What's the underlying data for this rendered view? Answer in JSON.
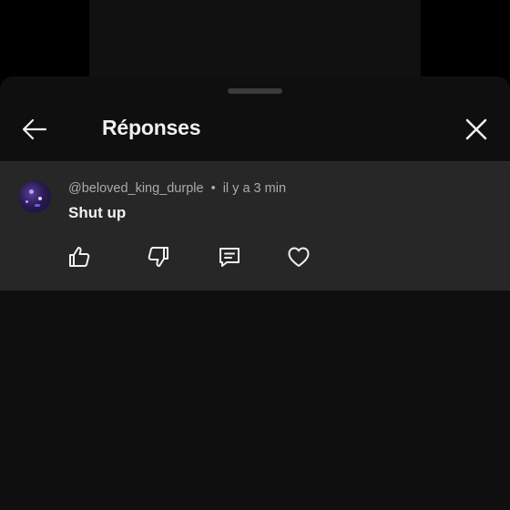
{
  "header": {
    "title": "Réponses",
    "back_icon": "arrow-left-icon",
    "close_icon": "close-icon"
  },
  "comment": {
    "author": "@beloved_king_durple",
    "separator": "•",
    "timestamp": "il y a 3 min",
    "text": "Shut up",
    "actions": [
      "thumb-up-icon",
      "thumb-down-icon",
      "reply-icon",
      "heart-icon"
    ]
  },
  "colors": {
    "background": "#000000",
    "sheet": "#0f0f0f",
    "comment_bg": "#272727",
    "text_primary": "#f1f1f1",
    "text_secondary": "#aaaaaa"
  }
}
